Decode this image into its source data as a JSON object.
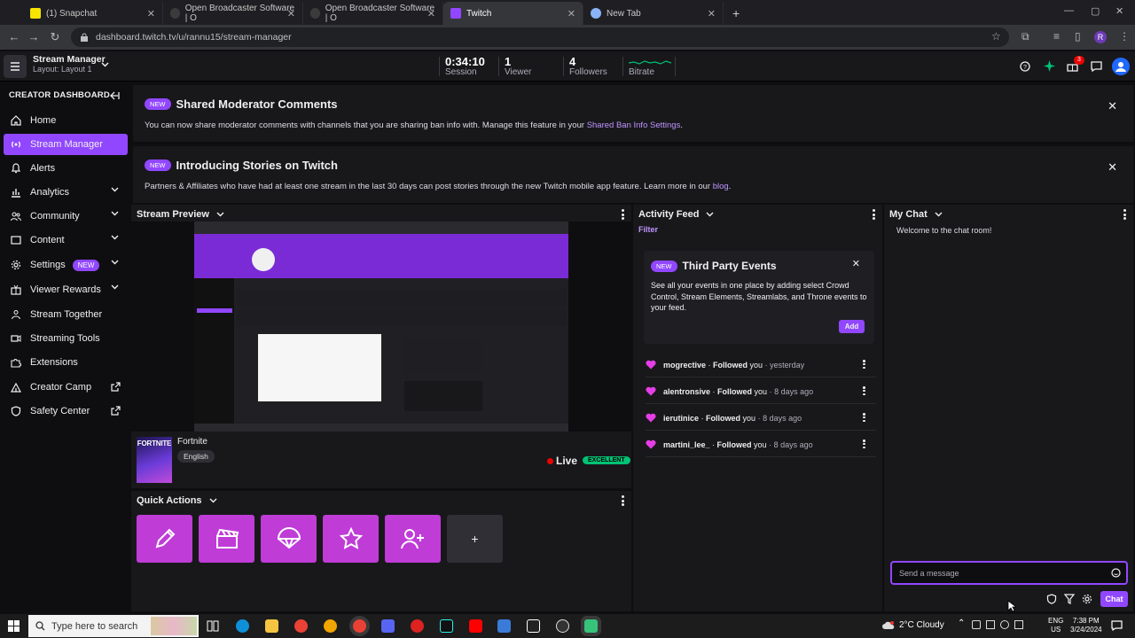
{
  "browser": {
    "tabs": [
      {
        "label": "(1) Snapchat",
        "icon_color": "#f7e400",
        "active": false
      },
      {
        "label": "Open Broadcaster Software | O",
        "icon_color": "#3b3b3b",
        "active": false
      },
      {
        "label": "Open Broadcaster Software | O",
        "icon_color": "#3b3b3b",
        "active": false
      },
      {
        "label": "Twitch",
        "icon_color": "#9147ff",
        "active": true
      },
      {
        "label": "New Tab",
        "icon_color": "#8ab4f8",
        "active": false
      }
    ],
    "url": "dashboard.twitch.tv/u/rannu15/stream-manager",
    "profile_initial": "R"
  },
  "topbar": {
    "title": "Stream Manager",
    "subtitle": "Layout: Layout 1",
    "stats": [
      {
        "value": "0:34:10",
        "label": "Session"
      },
      {
        "value": "1",
        "label": "Viewer"
      },
      {
        "value": "4",
        "label": "Followers"
      },
      {
        "value": "",
        "label": "Bitrate"
      }
    ],
    "notification_count": "3"
  },
  "sidebar": {
    "header": "CREATOR DASHBOARD",
    "items": [
      {
        "label": "Home",
        "icon": "home-icon"
      },
      {
        "label": "Stream Manager",
        "icon": "broadcast-icon",
        "active": true
      },
      {
        "label": "Alerts",
        "icon": "bell-icon"
      },
      {
        "label": "Analytics",
        "icon": "chart-icon",
        "expandable": true
      },
      {
        "label": "Community",
        "icon": "people-icon",
        "expandable": true
      },
      {
        "label": "Content",
        "icon": "content-icon",
        "expandable": true
      },
      {
        "label": "Settings",
        "icon": "gear-icon",
        "expandable": true,
        "badge": "NEW"
      },
      {
        "label": "Viewer Rewards",
        "icon": "reward-icon",
        "expandable": true
      },
      {
        "label": "Stream Together",
        "icon": "together-icon"
      },
      {
        "label": "Streaming Tools",
        "icon": "video-icon"
      },
      {
        "label": "Extensions",
        "icon": "puzzle-icon"
      },
      {
        "label": "Creator Camp",
        "icon": "camp-icon",
        "external": true
      },
      {
        "label": "Safety Center",
        "icon": "shield-icon",
        "external": true
      }
    ]
  },
  "banners": [
    {
      "badge": "NEW",
      "title": "Shared Moderator Comments",
      "text": "You can now share moderator comments with channels that you are sharing ban info with. Manage this feature in your ",
      "link": "Shared Ban Info Settings",
      "after": "."
    },
    {
      "badge": "NEW",
      "title": "Introducing Stories on Twitch",
      "text": "Partners & Affiliates who have had at least one stream in the last 30 days can post stories through the new Twitch mobile app feature. Learn more in our ",
      "link": "blog",
      "after": "."
    }
  ],
  "stream_preview": {
    "title": "Stream Preview",
    "game_cover_label": "FORTNITE",
    "game": "Fortnite",
    "language": "English",
    "live_label": "Live",
    "health": "EXCELLENT"
  },
  "quick_actions": {
    "title": "Quick Actions",
    "buttons": [
      "edit-stream-info",
      "clip",
      "ad-break",
      "raid-highlight",
      "follow-shoutout",
      "add"
    ]
  },
  "activity_feed": {
    "title": "Activity Feed",
    "filter": "Filter",
    "card": {
      "badge": "NEW",
      "title": "Third Party Events",
      "text": "See all your events in one place by adding select Crowd Control, Stream Elements, Streamlabs, and Throne events to your feed.",
      "button": "Add"
    },
    "events": [
      {
        "user": "mogrective",
        "action": "Followed",
        "suffix": "you",
        "time": "yesterday"
      },
      {
        "user": "alentronsive",
        "action": "Followed",
        "suffix": "you",
        "time": "8 days ago"
      },
      {
        "user": "ierutinice",
        "action": "Followed",
        "suffix": "you",
        "time": "8 days ago"
      },
      {
        "user": "martini_lee_",
        "action": "Followed",
        "suffix": "you",
        "time": "8 days ago"
      }
    ]
  },
  "chat": {
    "title": "My Chat",
    "welcome": "Welcome to the chat room!",
    "placeholder": "Send a message",
    "send_label": "Chat"
  },
  "taskbar": {
    "search_placeholder": "Type here to search",
    "weather": "2°C  Cloudy",
    "lang": "ENG",
    "region": "US",
    "time": "7:38 PM",
    "date": "3/24/2024"
  },
  "colors": {
    "accent": "#9147ff",
    "quick_action": "#bf3cd7",
    "live": "#eb0400",
    "excellent": "#00c274",
    "heart": "#e63ee6"
  }
}
